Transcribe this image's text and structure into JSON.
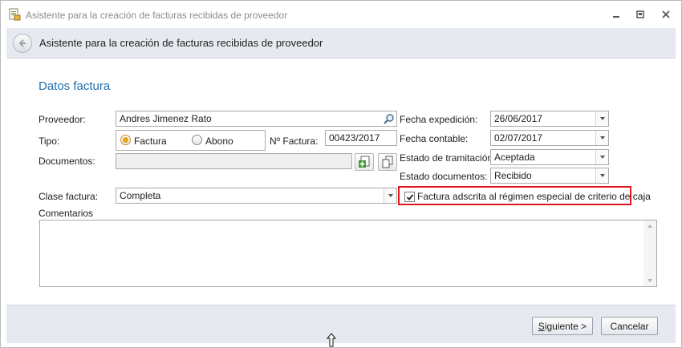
{
  "window": {
    "title": "Asistente para la creación de facturas recibidas de proveedor",
    "minimize_icon": "minimize-icon",
    "restore_icon": "restore-icon",
    "close_icon": "close-icon"
  },
  "header": {
    "back_icon": "back-arrow-icon",
    "title": "Asistente para la creación de facturas recibidas de proveedor"
  },
  "section": {
    "title": "Datos factura"
  },
  "form": {
    "proveedor": {
      "label": "Proveedor:",
      "value": "Andres Jimenez Rato",
      "search_icon": "search-icon"
    },
    "tipo": {
      "label": "Tipo:",
      "options": [
        {
          "label": "Factura",
          "selected": true
        },
        {
          "label": "Abono",
          "selected": false
        }
      ]
    },
    "n_factura": {
      "label": "Nº Factura:",
      "value": "00423/2017"
    },
    "documentos": {
      "label": "Documentos:",
      "value": "",
      "add_icon": "add-document-icon",
      "copy_icon": "copy-document-icon"
    },
    "clase_factura": {
      "label": "Clase factura:",
      "value": "Completa"
    },
    "fecha_expedicion": {
      "label": "Fecha expedición:",
      "value": "26/06/2017"
    },
    "fecha_contable": {
      "label": "Fecha contable:",
      "value": "02/07/2017"
    },
    "estado_tramitacion": {
      "label": "Estado de tramitación:",
      "value": "Aceptada"
    },
    "estado_documentos": {
      "label": "Estado documentos:",
      "value": "Recibido"
    },
    "criterio_caja": {
      "label": "Factura adscrita al régimen especial de criterio de caja",
      "checked": true
    },
    "comentarios": {
      "label": "Comentarios",
      "value": ""
    }
  },
  "footer": {
    "next": {
      "prefix": "S",
      "rest": "iguiente >"
    },
    "cancel": "Cancelar"
  },
  "colors": {
    "accent": "#1f6fb0",
    "highlight_border": "#e0151d",
    "band": "#e6e9ef"
  }
}
